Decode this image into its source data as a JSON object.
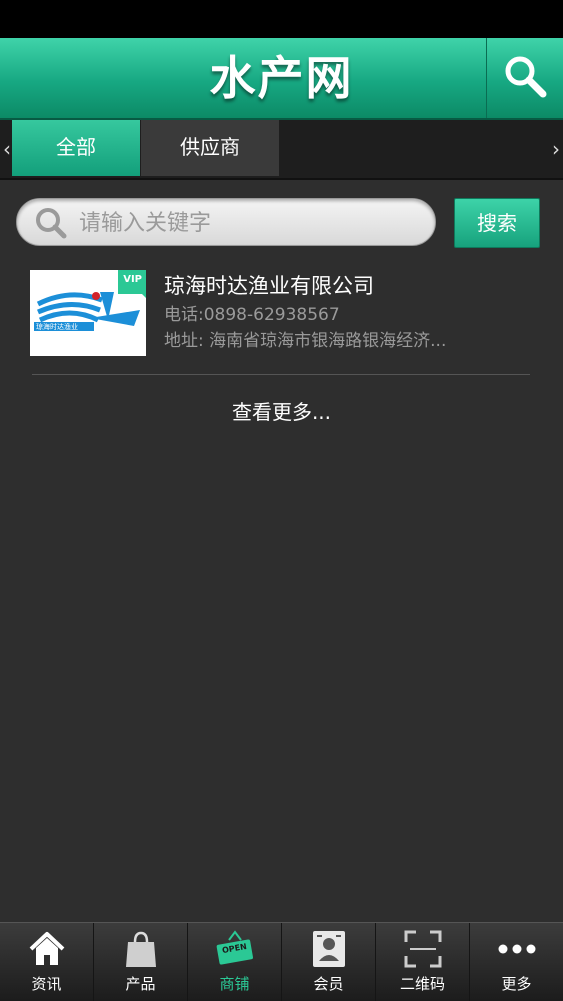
{
  "app": {
    "title": "水产网"
  },
  "tabs": [
    {
      "label": "全部",
      "active": true
    },
    {
      "label": "供应商",
      "active": false
    }
  ],
  "tab_arrows": {
    "left": "‹",
    "right": "›"
  },
  "search": {
    "placeholder": "请输入关键字",
    "value": "",
    "button_label": "搜索"
  },
  "list": [
    {
      "company": "琼海时达渔业有限公司",
      "phone": "电话:0898-62938567",
      "address": "地址: 海南省琼海市银海路银海经济...",
      "logo_text": "琼海时达渔业",
      "badge": "VIP"
    }
  ],
  "more_label": "查看更多...",
  "bottom_nav": [
    {
      "label": "资讯",
      "icon": "home-icon",
      "active": false
    },
    {
      "label": "产品",
      "icon": "shopping-bag-icon",
      "active": false
    },
    {
      "label": "商铺",
      "icon": "open-sign-icon",
      "active": true,
      "icon_text": "OPEN"
    },
    {
      "label": "会员",
      "icon": "member-card-icon",
      "active": false
    },
    {
      "label": "二维码",
      "icon": "qr-scan-icon",
      "active": false
    },
    {
      "label": "更多",
      "icon": "more-dots-icon",
      "active": false
    }
  ],
  "colors": {
    "accent": "#1fb48b",
    "active_nav": "#2bc895",
    "background": "#2e2e2e"
  }
}
